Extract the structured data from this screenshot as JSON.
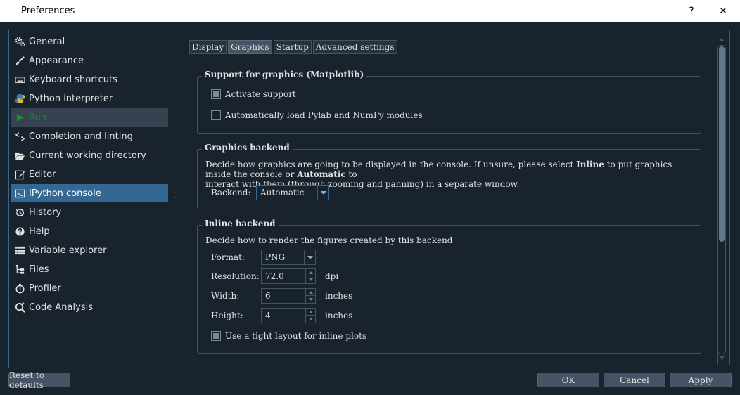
{
  "window": {
    "title": "Preferences",
    "help_glyph": "?",
    "close_glyph": "✕"
  },
  "sidebar": {
    "items": [
      {
        "label": "General",
        "icon": "gear-icon"
      },
      {
        "label": "Appearance",
        "icon": "paintbrush-icon"
      },
      {
        "label": "Keyboard shortcuts",
        "icon": "keyboard-icon"
      },
      {
        "label": "Python interpreter",
        "icon": "python-icon"
      },
      {
        "label": "Run",
        "icon": "play-icon"
      },
      {
        "label": "Completion and linting",
        "icon": "completion-icon"
      },
      {
        "label": "Current working directory",
        "icon": "folder-open-icon"
      },
      {
        "label": "Editor",
        "icon": "edit-icon"
      },
      {
        "label": "IPython console",
        "icon": "terminal-icon"
      },
      {
        "label": "History",
        "icon": "history-icon"
      },
      {
        "label": "Help",
        "icon": "question-icon"
      },
      {
        "label": "Variable explorer",
        "icon": "table-icon"
      },
      {
        "label": "Files",
        "icon": "files-icon"
      },
      {
        "label": "Profiler",
        "icon": "stopwatch-icon"
      },
      {
        "label": "Code Analysis",
        "icon": "code-analysis-icon"
      }
    ]
  },
  "tabs": [
    {
      "label": "Display",
      "active": false
    },
    {
      "label": "Graphics",
      "active": true
    },
    {
      "label": "Startup",
      "active": false
    },
    {
      "label": "Advanced settings",
      "active": false
    }
  ],
  "support_group": {
    "title": "Support for graphics (Matplotlib)",
    "activate_label": "Activate support",
    "activate_checked": true,
    "autoload_label": "Automatically load Pylab and NumPy modules",
    "autoload_checked": false
  },
  "backend_group": {
    "title": "Graphics backend",
    "desc_1": "Decide how graphics are going to be displayed in the console. If unsure, please select ",
    "desc_inline": "Inline",
    "desc_2": " to put graphics inside the console or ",
    "desc_auto": "Automatic",
    "desc_3": " to",
    "desc_line2": "interact with them (through zooming and panning) in a separate window.",
    "backend_label": "Backend:",
    "backend_value": "Automatic"
  },
  "inline_group": {
    "title": "Inline backend",
    "desc": "Decide how to render the figures created by this backend",
    "format_label": "Format:",
    "format_value": "PNG",
    "resolution_label": "Resolution:",
    "resolution_value": "72.0",
    "resolution_unit": "dpi",
    "width_label": "Width:",
    "width_value": "6",
    "width_unit": "inches",
    "height_label": "Height:",
    "height_value": "4",
    "height_unit": "inches",
    "tight_label": "Use a tight layout for inline plots",
    "tight_checked": true
  },
  "footer": {
    "reset_label": "Reset to defaults",
    "ok_label": "OK",
    "cancel_label": "Cancel",
    "apply_label": "Apply"
  },
  "colors": {
    "background": "#19232d",
    "selection": "#346792",
    "run_green": "#1b8b32",
    "border": "#455364"
  }
}
